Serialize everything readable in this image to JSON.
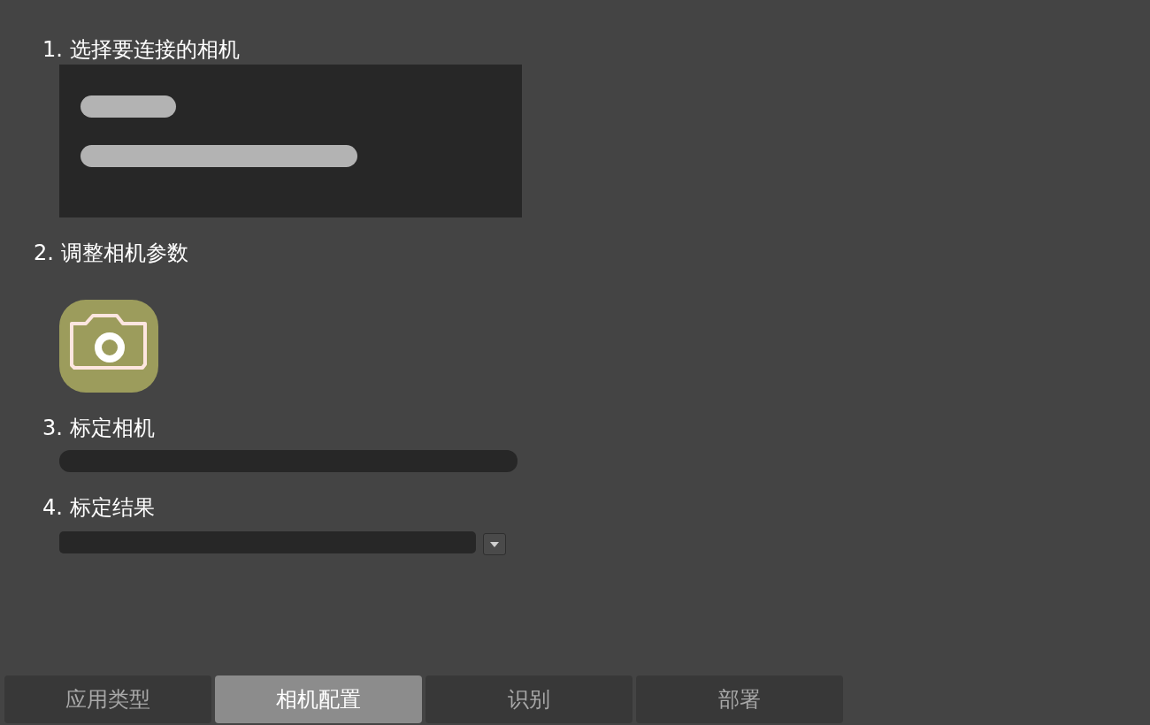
{
  "steps": [
    {
      "kind": "device-list",
      "label": "1. 选择要连接的相机"
    },
    {
      "kind": "camera-button",
      "label": "2. 调整相机参数"
    },
    {
      "kind": "progress",
      "label": "3. 标定相机"
    },
    {
      "kind": "dropdown",
      "label": "4. 标定结果"
    }
  ],
  "tabs": [
    {
      "label": "应用类型",
      "selected": false
    },
    {
      "label": "相机配置",
      "selected": true
    },
    {
      "label": "识别",
      "selected": false
    },
    {
      "label": "部署",
      "selected": false
    }
  ]
}
